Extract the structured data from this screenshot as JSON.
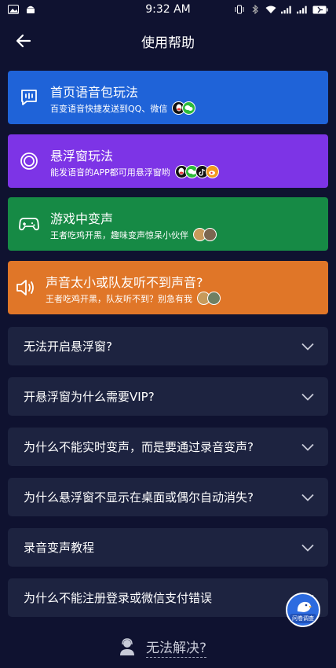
{
  "status_bar": {
    "time": "9:32 AM",
    "battery": "battery-icon"
  },
  "header": {
    "title": "使用帮助"
  },
  "features": [
    {
      "title": "首页语音包玩法",
      "subtitle": "百变语音快捷发送到QQ、微信",
      "color": "#1f63d8",
      "icon": "message-icon"
    },
    {
      "title": "悬浮窗玩法",
      "subtitle": "能发语音的APP都可用悬浮窗哟",
      "color": "#7d34e6",
      "icon": "circle-target-icon"
    },
    {
      "title": "游戏中变声",
      "subtitle": "王者吃鸡开黑，趣味变声惊呆小伙伴",
      "color": "#168a45",
      "icon": "gamepad-icon"
    },
    {
      "title": "声音太小或队友听不到声音?",
      "subtitle": "王者吃鸡开黑，队友听不到？别急有我",
      "color": "#e07628",
      "icon": "speaker-icon"
    }
  ],
  "faqs": [
    "无法开启悬浮窗?",
    "开悬浮窗为什么需要VIP?",
    "为什么不能实时变声，而是要通过录音变声?",
    "为什么悬浮窗不显示在桌面或偶尔自动消失?",
    "录音变声教程",
    "为什么不能注册登录或微信支付错误"
  ],
  "survey": {
    "label": "问卷调查"
  },
  "footer": {
    "unsolved_label": "无法解决?"
  }
}
